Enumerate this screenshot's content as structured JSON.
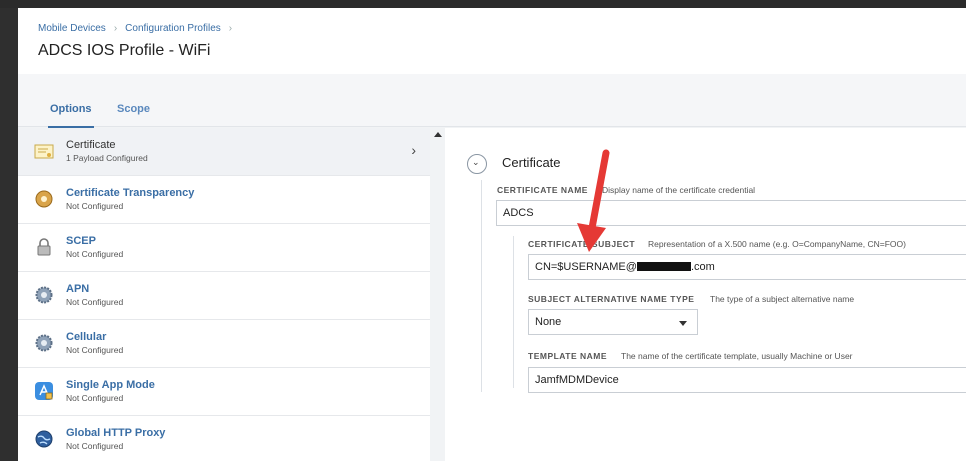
{
  "breadcrumb": {
    "items": [
      "Mobile Devices",
      "Configuration Profiles"
    ]
  },
  "title": "ADCS IOS Profile - WiFi",
  "tabs": [
    {
      "label": "Options"
    },
    {
      "label": "Scope"
    }
  ],
  "payloads": [
    {
      "name": "Certificate",
      "status": "1 Payload Configured",
      "icon": "certificate-icon"
    },
    {
      "name": "Certificate Transparency",
      "status": "Not Configured",
      "icon": "certificate-transparency-icon"
    },
    {
      "name": "SCEP",
      "status": "Not Configured",
      "icon": "lock-icon"
    },
    {
      "name": "APN",
      "status": "Not Configured",
      "icon": "gear-icon"
    },
    {
      "name": "Cellular",
      "status": "Not Configured",
      "icon": "gear-icon"
    },
    {
      "name": "Single App Mode",
      "status": "Not Configured",
      "icon": "app-store-icon"
    },
    {
      "name": "Global HTTP Proxy",
      "status": "Not Configured",
      "icon": "globe-icon"
    }
  ],
  "detail": {
    "section_title": "Certificate",
    "certificate_name": {
      "label": "CERTIFICATE NAME",
      "help": "Display name of the certificate credential",
      "value": "ADCS"
    },
    "certificate_subject": {
      "label": "CERTIFICATE SUBJECT",
      "help": "Representation of a X.500 name (e.g. O=CompanyName, CN=FOO)",
      "value_prefix": "CN=$USERNAME@",
      "value_suffix": ".com"
    },
    "san_type": {
      "label": "SUBJECT ALTERNATIVE NAME TYPE",
      "help": "The type of a subject alternative name",
      "value": "None"
    },
    "template_name": {
      "label": "TEMPLATE NAME",
      "help": "The name of the certificate template, usually Machine or User",
      "value": "JamfMDMDevice"
    }
  },
  "colors": {
    "accent": "#3a6ea5",
    "annotation_arrow": "#e53935"
  }
}
